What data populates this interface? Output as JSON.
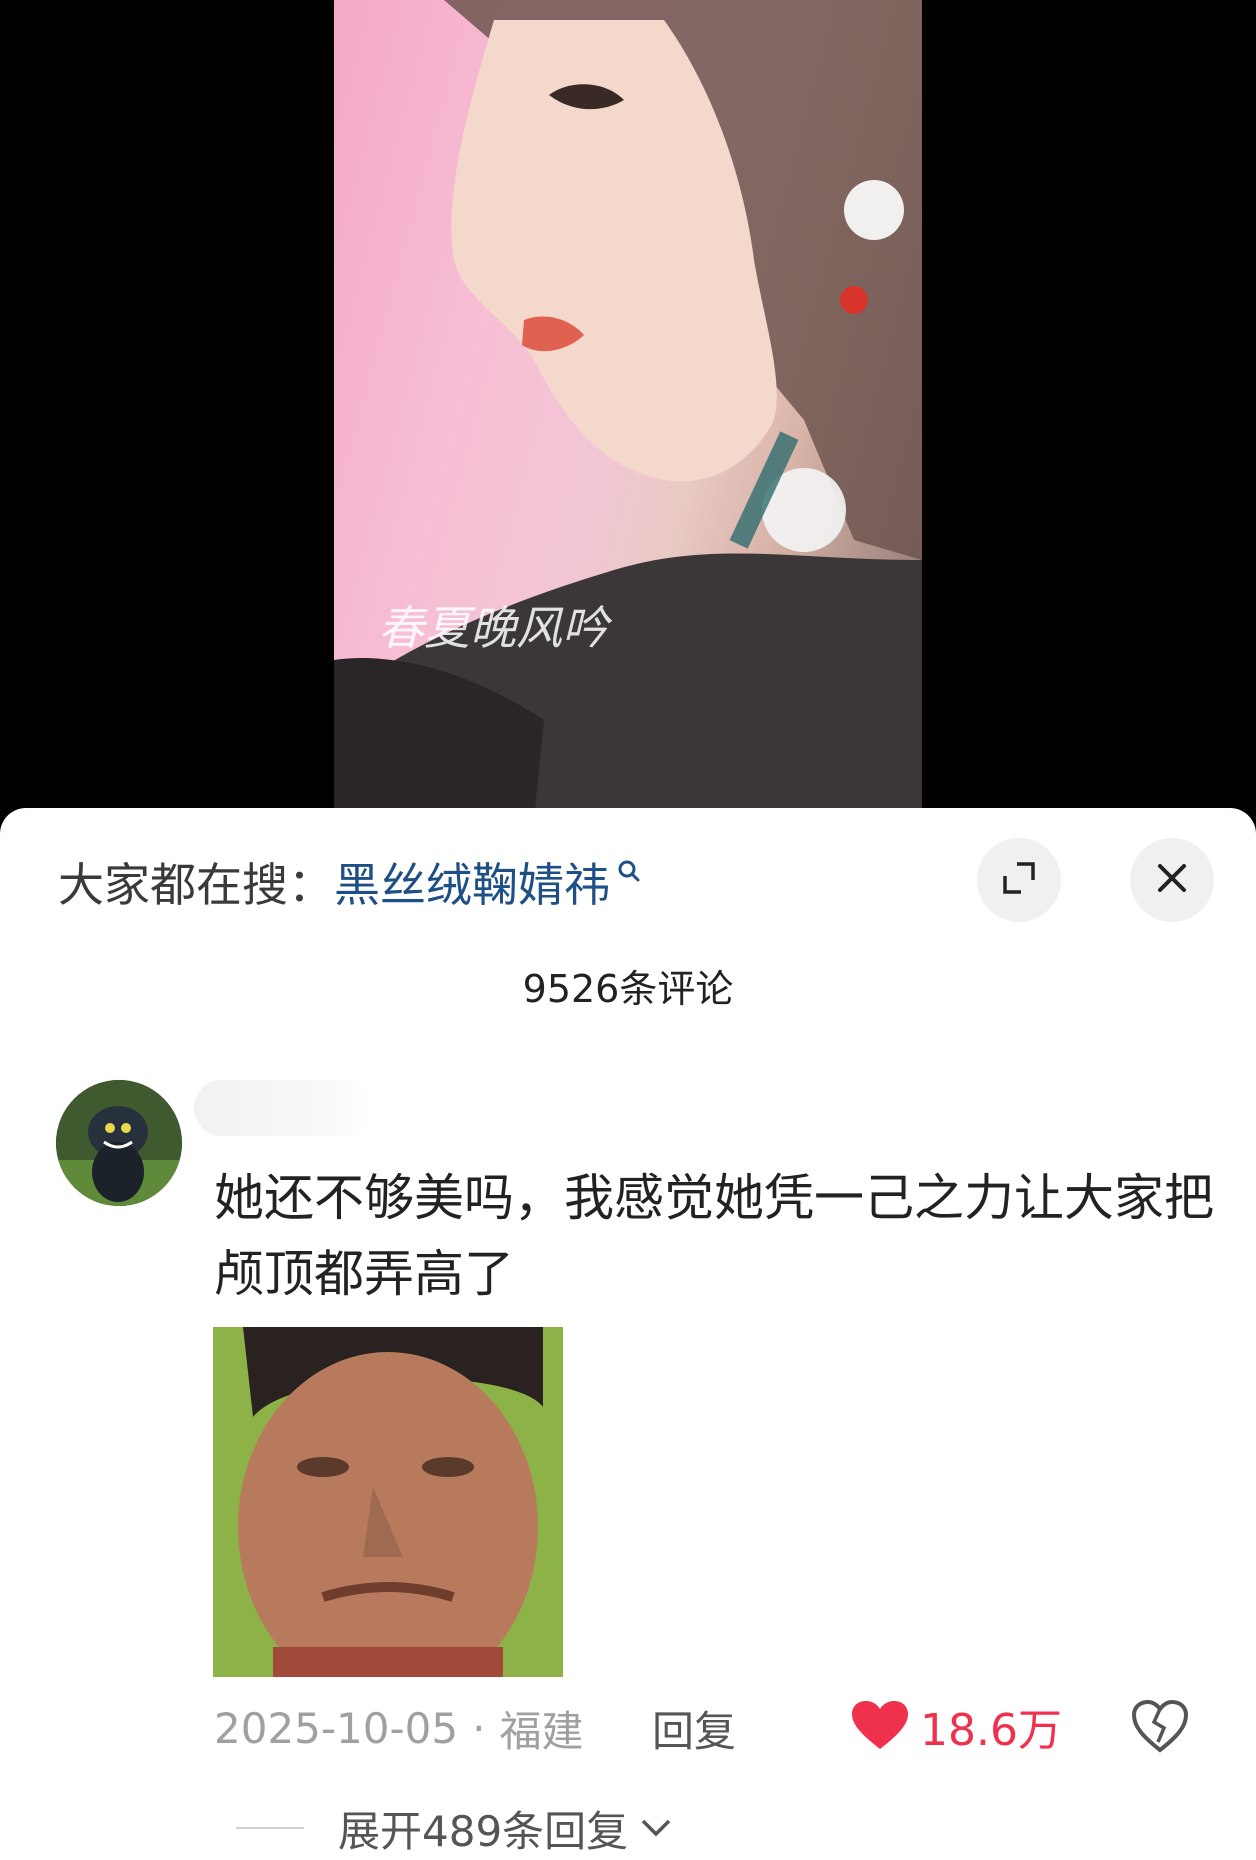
{
  "video": {
    "watermark": "春夏晚风吟"
  },
  "search": {
    "prefix": "大家都在搜：",
    "term": "黑丝绒鞠婧祎"
  },
  "panel": {
    "comment_count": "9526条评论"
  },
  "comment": {
    "text": "她还不够美吗，我感觉她凭一己之力让大家把颅顶都弄高了",
    "date": "2025-10-05",
    "separator": "·",
    "location": "福建",
    "reply_label": "回复",
    "like_count": "18.6万",
    "expand_replies": "展开489条回复"
  },
  "colors": {
    "search_term": "#1e4f86",
    "like": "#f0314e",
    "meta": "#a0a0a0"
  },
  "icons": {
    "search": "search-icon",
    "expand": "fullscreen-icon",
    "close": "close-icon",
    "like": "heart-icon",
    "dislike": "broken-heart-icon",
    "chevron": "chevron-down-icon"
  }
}
